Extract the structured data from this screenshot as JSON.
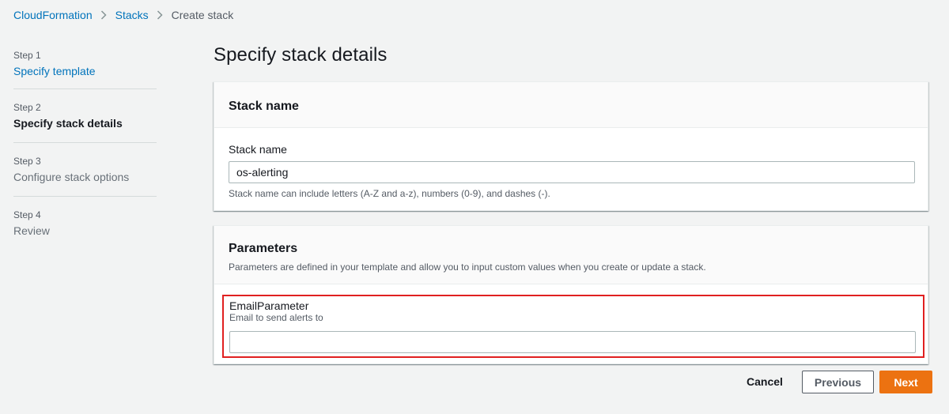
{
  "breadcrumb": {
    "items": [
      "CloudFormation",
      "Stacks"
    ],
    "current": "Create stack"
  },
  "steps": [
    {
      "num": "Step 1",
      "title": "Specify template",
      "state": "link"
    },
    {
      "num": "Step 2",
      "title": "Specify stack details",
      "state": "current"
    },
    {
      "num": "Step 3",
      "title": "Configure stack options",
      "state": "future"
    },
    {
      "num": "Step 4",
      "title": "Review",
      "state": "future"
    }
  ],
  "page": {
    "title": "Specify stack details"
  },
  "stack_panel": {
    "header": "Stack name",
    "field_label": "Stack name",
    "field_value": "os-alerting",
    "field_help": "Stack name can include letters (A-Z and a-z), numbers (0-9), and dashes (-)."
  },
  "params_panel": {
    "header": "Parameters",
    "description": "Parameters are defined in your template and allow you to input custom values when you create or update a stack.",
    "email_param": {
      "label": "EmailParameter",
      "description": "Email to send alerts to",
      "value": ""
    }
  },
  "footer": {
    "cancel": "Cancel",
    "previous": "Previous",
    "next": "Next"
  },
  "colors": {
    "link": "#0073bb",
    "primary_button": "#ec7211",
    "highlight": "#e02020",
    "background": "#f2f3f3"
  },
  "icons": {
    "breadcrumb_separator": "chevron-right-icon"
  }
}
